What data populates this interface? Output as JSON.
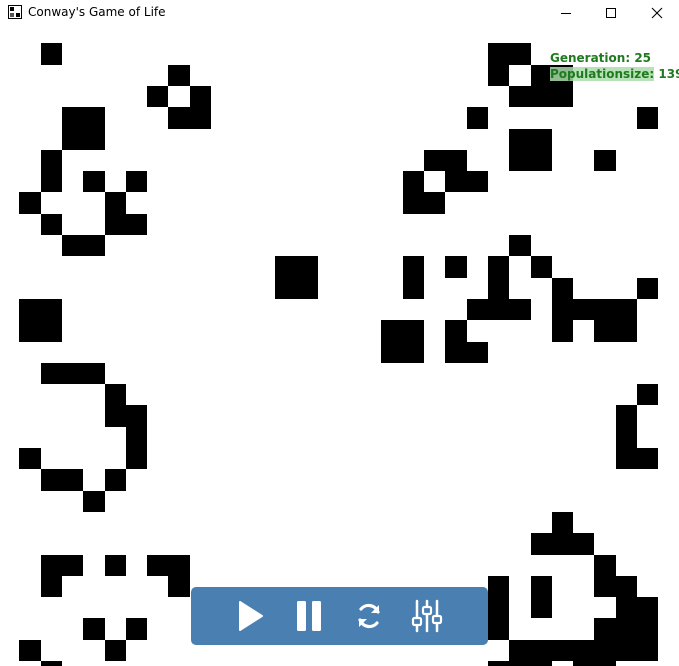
{
  "window": {
    "title": "Conway's Game of Life",
    "app_icon": "checkerboard-icon",
    "controls": [
      "minimize-icon",
      "maximize-icon",
      "close-icon"
    ]
  },
  "stats": {
    "generation_label": "Generation:",
    "generation": "25",
    "population_label_part1": "Population",
    "population_label_part2": "size:",
    "population": "139"
  },
  "controls": {
    "buttons": [
      {
        "name": "play-button",
        "icon": "play-icon"
      },
      {
        "name": "pause-button",
        "icon": "pause-icon"
      },
      {
        "name": "reset-button",
        "icon": "refresh-icon"
      },
      {
        "name": "settings-button",
        "icon": "sliders-icon"
      }
    ]
  },
  "colors": {
    "cell": "#000000",
    "background": "#ffffff",
    "stats_text": "#1f7a1f",
    "toolbar": "#4a7fb1",
    "toolbar_icon": "#ffffff"
  },
  "board": {
    "alive_cells": [
      [
        2,
        1
      ],
      [
        23,
        1
      ],
      [
        24,
        1
      ],
      [
        8,
        2
      ],
      [
        23,
        2
      ],
      [
        25,
        2
      ],
      [
        26,
        2
      ],
      [
        7,
        3
      ],
      [
        9,
        3
      ],
      [
        24,
        3
      ],
      [
        25,
        3
      ],
      [
        26,
        3
      ],
      [
        3,
        4
      ],
      [
        4,
        4
      ],
      [
        8,
        4
      ],
      [
        9,
        4
      ],
      [
        22,
        4
      ],
      [
        30,
        4
      ],
      [
        3,
        5
      ],
      [
        4,
        5
      ],
      [
        24,
        5
      ],
      [
        25,
        5
      ],
      [
        2,
        6
      ],
      [
        20,
        6
      ],
      [
        21,
        6
      ],
      [
        24,
        6
      ],
      [
        25,
        6
      ],
      [
        28,
        6
      ],
      [
        2,
        7
      ],
      [
        4,
        7
      ],
      [
        6,
        7
      ],
      [
        19,
        7
      ],
      [
        21,
        7
      ],
      [
        22,
        7
      ],
      [
        1,
        8
      ],
      [
        5,
        8
      ],
      [
        19,
        8
      ],
      [
        20,
        8
      ],
      [
        2,
        9
      ],
      [
        5,
        9
      ],
      [
        6,
        9
      ],
      [
        3,
        10
      ],
      [
        4,
        10
      ],
      [
        24,
        10
      ],
      [
        13,
        11
      ],
      [
        14,
        11
      ],
      [
        19,
        11
      ],
      [
        21,
        11
      ],
      [
        23,
        11
      ],
      [
        25,
        11
      ],
      [
        13,
        12
      ],
      [
        14,
        12
      ],
      [
        19,
        12
      ],
      [
        23,
        12
      ],
      [
        26,
        12
      ],
      [
        30,
        12
      ],
      [
        1,
        13
      ],
      [
        2,
        13
      ],
      [
        22,
        13
      ],
      [
        23,
        13
      ],
      [
        24,
        13
      ],
      [
        26,
        13
      ],
      [
        27,
        13
      ],
      [
        28,
        13
      ],
      [
        29,
        13
      ],
      [
        1,
        14
      ],
      [
        2,
        14
      ],
      [
        18,
        14
      ],
      [
        19,
        14
      ],
      [
        21,
        14
      ],
      [
        26,
        14
      ],
      [
        28,
        14
      ],
      [
        29,
        14
      ],
      [
        18,
        15
      ],
      [
        19,
        15
      ],
      [
        21,
        15
      ],
      [
        22,
        15
      ],
      [
        2,
        16
      ],
      [
        3,
        16
      ],
      [
        4,
        16
      ],
      [
        5,
        17
      ],
      [
        30,
        17
      ],
      [
        5,
        18
      ],
      [
        6,
        18
      ],
      [
        29,
        18
      ],
      [
        6,
        19
      ],
      [
        29,
        19
      ],
      [
        1,
        20
      ],
      [
        6,
        20
      ],
      [
        29,
        20
      ],
      [
        30,
        20
      ],
      [
        2,
        21
      ],
      [
        3,
        21
      ],
      [
        5,
        21
      ],
      [
        4,
        22
      ],
      [
        26,
        23
      ],
      [
        25,
        24
      ],
      [
        26,
        24
      ],
      [
        27,
        24
      ],
      [
        2,
        25
      ],
      [
        3,
        25
      ],
      [
        5,
        25
      ],
      [
        7,
        25
      ],
      [
        8,
        25
      ],
      [
        28,
        25
      ],
      [
        2,
        26
      ],
      [
        8,
        26
      ],
      [
        23,
        26
      ],
      [
        25,
        26
      ],
      [
        28,
        26
      ],
      [
        29,
        26
      ],
      [
        22,
        27
      ],
      [
        23,
        27
      ],
      [
        25,
        27
      ],
      [
        29,
        27
      ],
      [
        30,
        27
      ],
      [
        4,
        28
      ],
      [
        6,
        28
      ],
      [
        23,
        28
      ],
      [
        28,
        28
      ],
      [
        29,
        28
      ],
      [
        30,
        28
      ],
      [
        1,
        29
      ],
      [
        5,
        29
      ],
      [
        24,
        29
      ],
      [
        25,
        29
      ],
      [
        26,
        29
      ],
      [
        27,
        29
      ],
      [
        28,
        29
      ],
      [
        29,
        29
      ],
      [
        30,
        29
      ],
      [
        2,
        30
      ],
      [
        23,
        30
      ],
      [
        24,
        30
      ],
      [
        25,
        30
      ],
      [
        27,
        30
      ],
      [
        28,
        30
      ]
    ]
  }
}
